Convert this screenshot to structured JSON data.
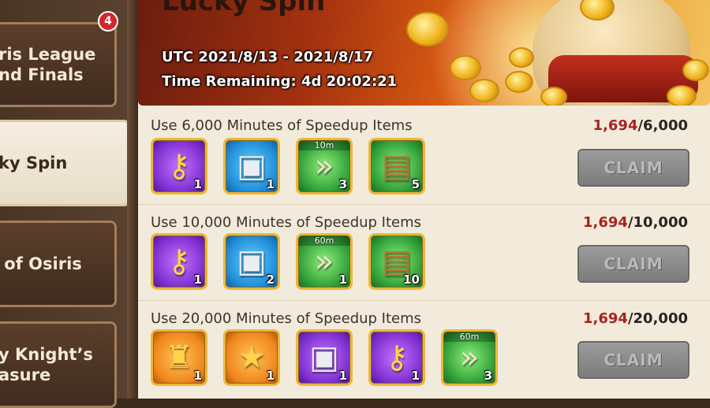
{
  "sidebar": {
    "tabs": [
      {
        "label": "ris League\nnd Finals",
        "badge": "4"
      },
      {
        "label": "ky Spin"
      },
      {
        "label": " of Osiris"
      },
      {
        "label": "y Knight’s\nasure"
      }
    ]
  },
  "banner": {
    "title": "Lucky Spin",
    "date_range": "UTC 2021/8/13 - 2021/8/17",
    "time_remaining": "Time Remaining: 4d 20:02:21"
  },
  "rows": [
    {
      "title": "Use 6,000 Minutes of Speedup Items",
      "progress_current": "1,694",
      "progress_total": "/6,000",
      "claim_label": "CLAIM",
      "items": [
        {
          "icon": "golden-key-icon",
          "qty": "1"
        },
        {
          "icon": "silver-chest-icon",
          "qty": "1"
        },
        {
          "icon": "speedup-icon",
          "qty": "3",
          "duration": "10m"
        },
        {
          "icon": "resource-chest-icon",
          "qty": "5"
        }
      ]
    },
    {
      "title": "Use 10,000 Minutes of Speedup Items",
      "progress_current": "1,694",
      "progress_total": "/10,000",
      "claim_label": "CLAIM",
      "items": [
        {
          "icon": "golden-key-icon",
          "qty": "1"
        },
        {
          "icon": "silver-chest-icon",
          "qty": "2"
        },
        {
          "icon": "speedup-icon",
          "qty": "1",
          "duration": "60m"
        },
        {
          "icon": "resource-chest-icon",
          "qty": "10"
        }
      ]
    },
    {
      "title": "Use 20,000 Minutes of Speedup Items",
      "progress_current": "1,694",
      "progress_total": "/20,000",
      "claim_label": "CLAIM",
      "items": [
        {
          "icon": "golden-sculpture-icon",
          "qty": "1"
        },
        {
          "icon": "star-trophy-icon",
          "qty": "1"
        },
        {
          "icon": "silver-chest-icon",
          "qty": "1"
        },
        {
          "icon": "golden-key-icon",
          "qty": "1"
        },
        {
          "icon": "speedup-icon",
          "qty": "3",
          "duration": "60m"
        }
      ]
    }
  ],
  "colors": {
    "accent_red": "#a7231f",
    "badge_red": "#d3262b",
    "claim_disabled": "#8c8c8c"
  }
}
